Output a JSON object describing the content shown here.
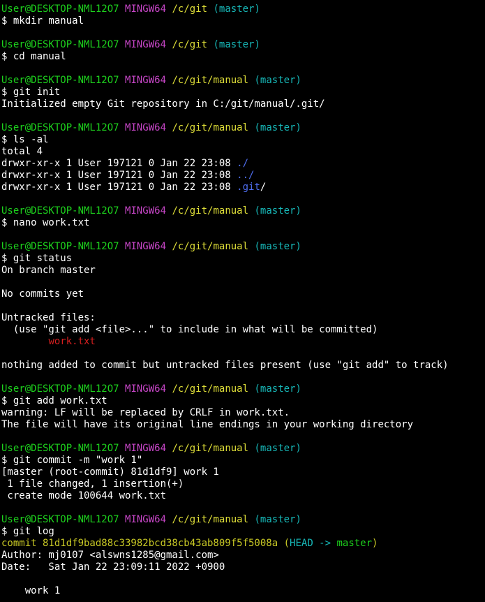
{
  "window": {
    "background": "#000000",
    "colors": {
      "user": "#1dd11d",
      "mingw": "#c746c7",
      "path": "#dede38",
      "branch": "#17b8b8",
      "dir": "#4f6ef0",
      "untracked": "#d61f1f",
      "commit_hash": "#c9c925",
      "text": "#ffffff"
    }
  },
  "lines": [
    [
      {
        "t": "User@DESKTOP-NML12O7",
        "c": "user"
      },
      {
        "t": " "
      },
      {
        "t": "MINGW64",
        "c": "ming"
      },
      {
        "t": " "
      },
      {
        "t": "/c/git",
        "c": "path"
      },
      {
        "t": " "
      },
      {
        "t": "(master)",
        "c": "branch"
      }
    ],
    [
      {
        "t": "$ mkdir manual"
      }
    ],
    [],
    [
      {
        "t": "User@DESKTOP-NML12O7",
        "c": "user"
      },
      {
        "t": " "
      },
      {
        "t": "MINGW64",
        "c": "ming"
      },
      {
        "t": " "
      },
      {
        "t": "/c/git",
        "c": "path"
      },
      {
        "t": " "
      },
      {
        "t": "(master)",
        "c": "branch"
      }
    ],
    [
      {
        "t": "$ cd manual"
      }
    ],
    [],
    [
      {
        "t": "User@DESKTOP-NML12O7",
        "c": "user"
      },
      {
        "t": " "
      },
      {
        "t": "MINGW64",
        "c": "ming"
      },
      {
        "t": " "
      },
      {
        "t": "/c/git/manual",
        "c": "path"
      },
      {
        "t": " "
      },
      {
        "t": "(master)",
        "c": "branch"
      }
    ],
    [
      {
        "t": "$ git init"
      }
    ],
    [
      {
        "t": "Initialized empty Git repository in C:/git/manual/.git/"
      }
    ],
    [],
    [
      {
        "t": "User@DESKTOP-NML12O7",
        "c": "user"
      },
      {
        "t": " "
      },
      {
        "t": "MINGW64",
        "c": "ming"
      },
      {
        "t": " "
      },
      {
        "t": "/c/git/manual",
        "c": "path"
      },
      {
        "t": " "
      },
      {
        "t": "(master)",
        "c": "branch"
      }
    ],
    [
      {
        "t": "$ ls -al"
      }
    ],
    [
      {
        "t": "total 4"
      }
    ],
    [
      {
        "t": "drwxr-xr-x 1 User 197121 0 Jan 22 23:08 "
      },
      {
        "t": "./",
        "c": "dir"
      }
    ],
    [
      {
        "t": "drwxr-xr-x 1 User 197121 0 Jan 22 23:08 "
      },
      {
        "t": "../",
        "c": "dir"
      }
    ],
    [
      {
        "t": "drwxr-xr-x 1 User 197121 0 Jan 22 23:08 "
      },
      {
        "t": ".git",
        "c": "dir"
      },
      {
        "t": "/"
      }
    ],
    [],
    [
      {
        "t": "User@DESKTOP-NML12O7",
        "c": "user"
      },
      {
        "t": " "
      },
      {
        "t": "MINGW64",
        "c": "ming"
      },
      {
        "t": " "
      },
      {
        "t": "/c/git/manual",
        "c": "path"
      },
      {
        "t": " "
      },
      {
        "t": "(master)",
        "c": "branch"
      }
    ],
    [
      {
        "t": "$ nano work.txt"
      }
    ],
    [],
    [
      {
        "t": "User@DESKTOP-NML12O7",
        "c": "user"
      },
      {
        "t": " "
      },
      {
        "t": "MINGW64",
        "c": "ming"
      },
      {
        "t": " "
      },
      {
        "t": "/c/git/manual",
        "c": "path"
      },
      {
        "t": " "
      },
      {
        "t": "(master)",
        "c": "branch"
      }
    ],
    [
      {
        "t": "$ git status"
      }
    ],
    [
      {
        "t": "On branch master"
      }
    ],
    [],
    [
      {
        "t": "No commits yet"
      }
    ],
    [],
    [
      {
        "t": "Untracked files:"
      }
    ],
    [
      {
        "t": "  (use \"git add <file>...\" to include in what will be committed)"
      }
    ],
    [
      {
        "t": "        "
      },
      {
        "t": "work.txt",
        "c": "red"
      }
    ],
    [],
    [
      {
        "t": "nothing added to commit but untracked files present (use \"git add\" to track)"
      }
    ],
    [],
    [
      {
        "t": "User@DESKTOP-NML12O7",
        "c": "user"
      },
      {
        "t": " "
      },
      {
        "t": "MINGW64",
        "c": "ming"
      },
      {
        "t": " "
      },
      {
        "t": "/c/git/manual",
        "c": "path"
      },
      {
        "t": " "
      },
      {
        "t": "(master)",
        "c": "branch"
      }
    ],
    [
      {
        "t": "$ git add work.txt"
      }
    ],
    [
      {
        "t": "warning: LF will be replaced by CRLF in work.txt."
      }
    ],
    [
      {
        "t": "The file will have its original line endings in your working directory"
      }
    ],
    [],
    [
      {
        "t": "User@DESKTOP-NML12O7",
        "c": "user"
      },
      {
        "t": " "
      },
      {
        "t": "MINGW64",
        "c": "ming"
      },
      {
        "t": " "
      },
      {
        "t": "/c/git/manual",
        "c": "path"
      },
      {
        "t": " "
      },
      {
        "t": "(master)",
        "c": "branch"
      }
    ],
    [
      {
        "t": "$ git commit -m \"work 1\""
      }
    ],
    [
      {
        "t": "[master (root-commit) 81d1df9] work 1"
      }
    ],
    [
      {
        "t": " 1 file changed, 1 insertion(+)"
      }
    ],
    [
      {
        "t": " create mode 100644 work.txt"
      }
    ],
    [],
    [
      {
        "t": "User@DESKTOP-NML12O7",
        "c": "user"
      },
      {
        "t": " "
      },
      {
        "t": "MINGW64",
        "c": "ming"
      },
      {
        "t": " "
      },
      {
        "t": "/c/git/manual",
        "c": "path"
      },
      {
        "t": " "
      },
      {
        "t": "(master)",
        "c": "branch"
      }
    ],
    [
      {
        "t": "$ git log"
      }
    ],
    [
      {
        "t": "commit 81d1df9bad88c33982bcd38cb43ab809f5f5008a",
        "c": "yellow"
      },
      {
        "t": " "
      },
      {
        "t": "(",
        "c": "yellow"
      },
      {
        "t": "HEAD -> ",
        "c": "branch"
      },
      {
        "t": "master",
        "c": "head"
      },
      {
        "t": ")",
        "c": "yellow"
      }
    ],
    [
      {
        "t": "Author: mj0107 <alswns1285@gmail.com>"
      }
    ],
    [
      {
        "t": "Date:   Sat Jan 22 23:09:11 2022 +0900"
      }
    ],
    [],
    [
      {
        "t": "    work 1"
      }
    ]
  ]
}
